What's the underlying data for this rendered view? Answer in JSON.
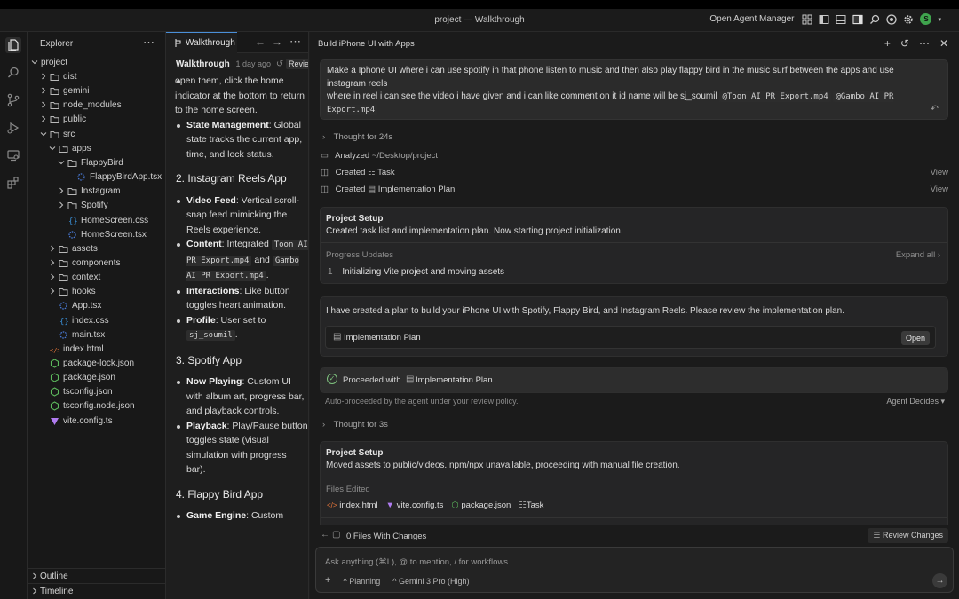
{
  "window": {
    "title": "project — Walkthrough",
    "agent_manager": "Open Agent Manager",
    "avatar_letter": "S"
  },
  "explorer": {
    "header": "Explorer",
    "root": "project",
    "items": [
      {
        "label": "dist",
        "kind": "folder",
        "depth": 1,
        "open": false
      },
      {
        "label": "gemini",
        "kind": "folder",
        "depth": 1,
        "open": false
      },
      {
        "label": "node_modules",
        "kind": "folder",
        "depth": 1,
        "open": false
      },
      {
        "label": "public",
        "kind": "folder",
        "depth": 1,
        "open": false
      },
      {
        "label": "src",
        "kind": "folder",
        "depth": 1,
        "open": true
      },
      {
        "label": "apps",
        "kind": "folder",
        "depth": 2,
        "open": true
      },
      {
        "label": "FlappyBird",
        "kind": "folder",
        "depth": 3,
        "open": true
      },
      {
        "label": "FlappyBirdApp.tsx",
        "kind": "tsx",
        "depth": 4
      },
      {
        "label": "Instagram",
        "kind": "folder",
        "depth": 3,
        "open": false
      },
      {
        "label": "Spotify",
        "kind": "folder",
        "depth": 3,
        "open": false
      },
      {
        "label": "HomeScreen.css",
        "kind": "css",
        "depth": 3
      },
      {
        "label": "HomeScreen.tsx",
        "kind": "tsx",
        "depth": 3
      },
      {
        "label": "assets",
        "kind": "folder",
        "depth": 2,
        "open": false
      },
      {
        "label": "components",
        "kind": "folder",
        "depth": 2,
        "open": false
      },
      {
        "label": "context",
        "kind": "folder",
        "depth": 2,
        "open": false
      },
      {
        "label": "hooks",
        "kind": "folder",
        "depth": 2,
        "open": false
      },
      {
        "label": "App.tsx",
        "kind": "tsx",
        "depth": 2
      },
      {
        "label": "index.css",
        "kind": "css",
        "depth": 2
      },
      {
        "label": "main.tsx",
        "kind": "tsx",
        "depth": 2
      },
      {
        "label": "index.html",
        "kind": "html",
        "depth": 1
      },
      {
        "label": "package-lock.json",
        "kind": "json",
        "depth": 1
      },
      {
        "label": "package.json",
        "kind": "json",
        "depth": 1
      },
      {
        "label": "tsconfig.json",
        "kind": "json",
        "depth": 1
      },
      {
        "label": "tsconfig.node.json",
        "kind": "json",
        "depth": 1
      },
      {
        "label": "vite.config.ts",
        "kind": "vite",
        "depth": 1
      }
    ],
    "outline": "Outline",
    "timeline": "Timeline"
  },
  "walkthrough": {
    "tab": "Walkthrough",
    "info_title": "Walkthrough",
    "info_time": "1 day ago",
    "info_review": "Review",
    "intro_text": "open them, click the home indicator at the bottom to return to the home screen.",
    "state_label": "State Management",
    "state_text": ": Global state tracks the current app, time, and lock status.",
    "sec2": "2. Instagram Reels App",
    "vf_label": "Video Feed",
    "vf_text": ": Vertical scroll-snap feed mimicking the Reels experience.",
    "content_label": "Content",
    "content_text1": ": Integrated ",
    "content_code1": "Toon AI PR Export.mp4",
    "content_and": " and ",
    "content_code2": "Gambo AI PR Export.mp4",
    "content_end": ".",
    "inter_label": "Interactions",
    "inter_text": ": Like button toggles heart animation.",
    "profile_label": "Profile",
    "profile_text": ": User set to ",
    "profile_code": "sj_soumil",
    "profile_end": ".",
    "sec3": "3. Spotify App",
    "np_label": "Now Playing",
    "np_text": ": Custom UI with album art, progress bar, and playback controls.",
    "pb_label": "Playback",
    "pb_text": ": Play/Pause button toggles state (visual simulation with progress bar).",
    "sec4": "4. Flappy Bird App",
    "ge_label": "Game Engine",
    "ge_text": ": Custom"
  },
  "agent": {
    "title": "Build iPhone UI with Apps",
    "request_line1": "Make a Iphone UI where i can use spotify in  that phone listen to music and then also play flappy bird in the music surf between the apps and use instagram reels",
    "request_line2": "where in reel i can see the video i have given and i can like comment on it id name will be sj_soumil ",
    "request_code1": "@Toon AI PR Export.mp4",
    "request_code2": "@Gambo AI PR Export.mp4",
    "thought1": "Thought for 24s",
    "analyzed_label": "Analyzed",
    "analyzed_path": "~/Desktop/project",
    "created1_label": "Created",
    "created1_item": "Task",
    "created2_label": "Created",
    "created2_item": "Implementation Plan",
    "view_label": "View",
    "setup1_title": "Project Setup",
    "setup1_text": "Created task list and implementation plan. Now starting project initialization.",
    "progress_label": "Progress Updates",
    "expand_all": "Expand all",
    "progress_item_num": "1",
    "progress_item": "Initializing Vite project and moving assets",
    "plan_msg": "I have created a plan to build your iPhone UI with Spotify, Flappy Bird, and Instagram Reels. Please review the implementation plan.",
    "plan_doc": "Implementation Plan",
    "open_btn": "Open",
    "proceeded_label": "Proceeded with",
    "proceeded_doc": "Implementation Plan",
    "auto_note": "Auto-proceeded by the agent under your review policy.",
    "agent_decides": "Agent Decides",
    "thought2": "Thought for 3s",
    "setup2_title": "Project Setup",
    "setup2_text": "Moved assets to public/videos. npm/npx unavailable, proceeding with manual file creation.",
    "files_edited": "Files Edited",
    "files": [
      "index.html",
      "vite.config.ts",
      "package.json",
      "Task"
    ],
    "changes": "0 Files With Changes",
    "review_changes": "Review Changes",
    "chat_placeholder": "Ask anything (⌘L), @ to mention, / for workflows",
    "mode": "Planning",
    "model": "Gemini 3 Pro (High)"
  }
}
